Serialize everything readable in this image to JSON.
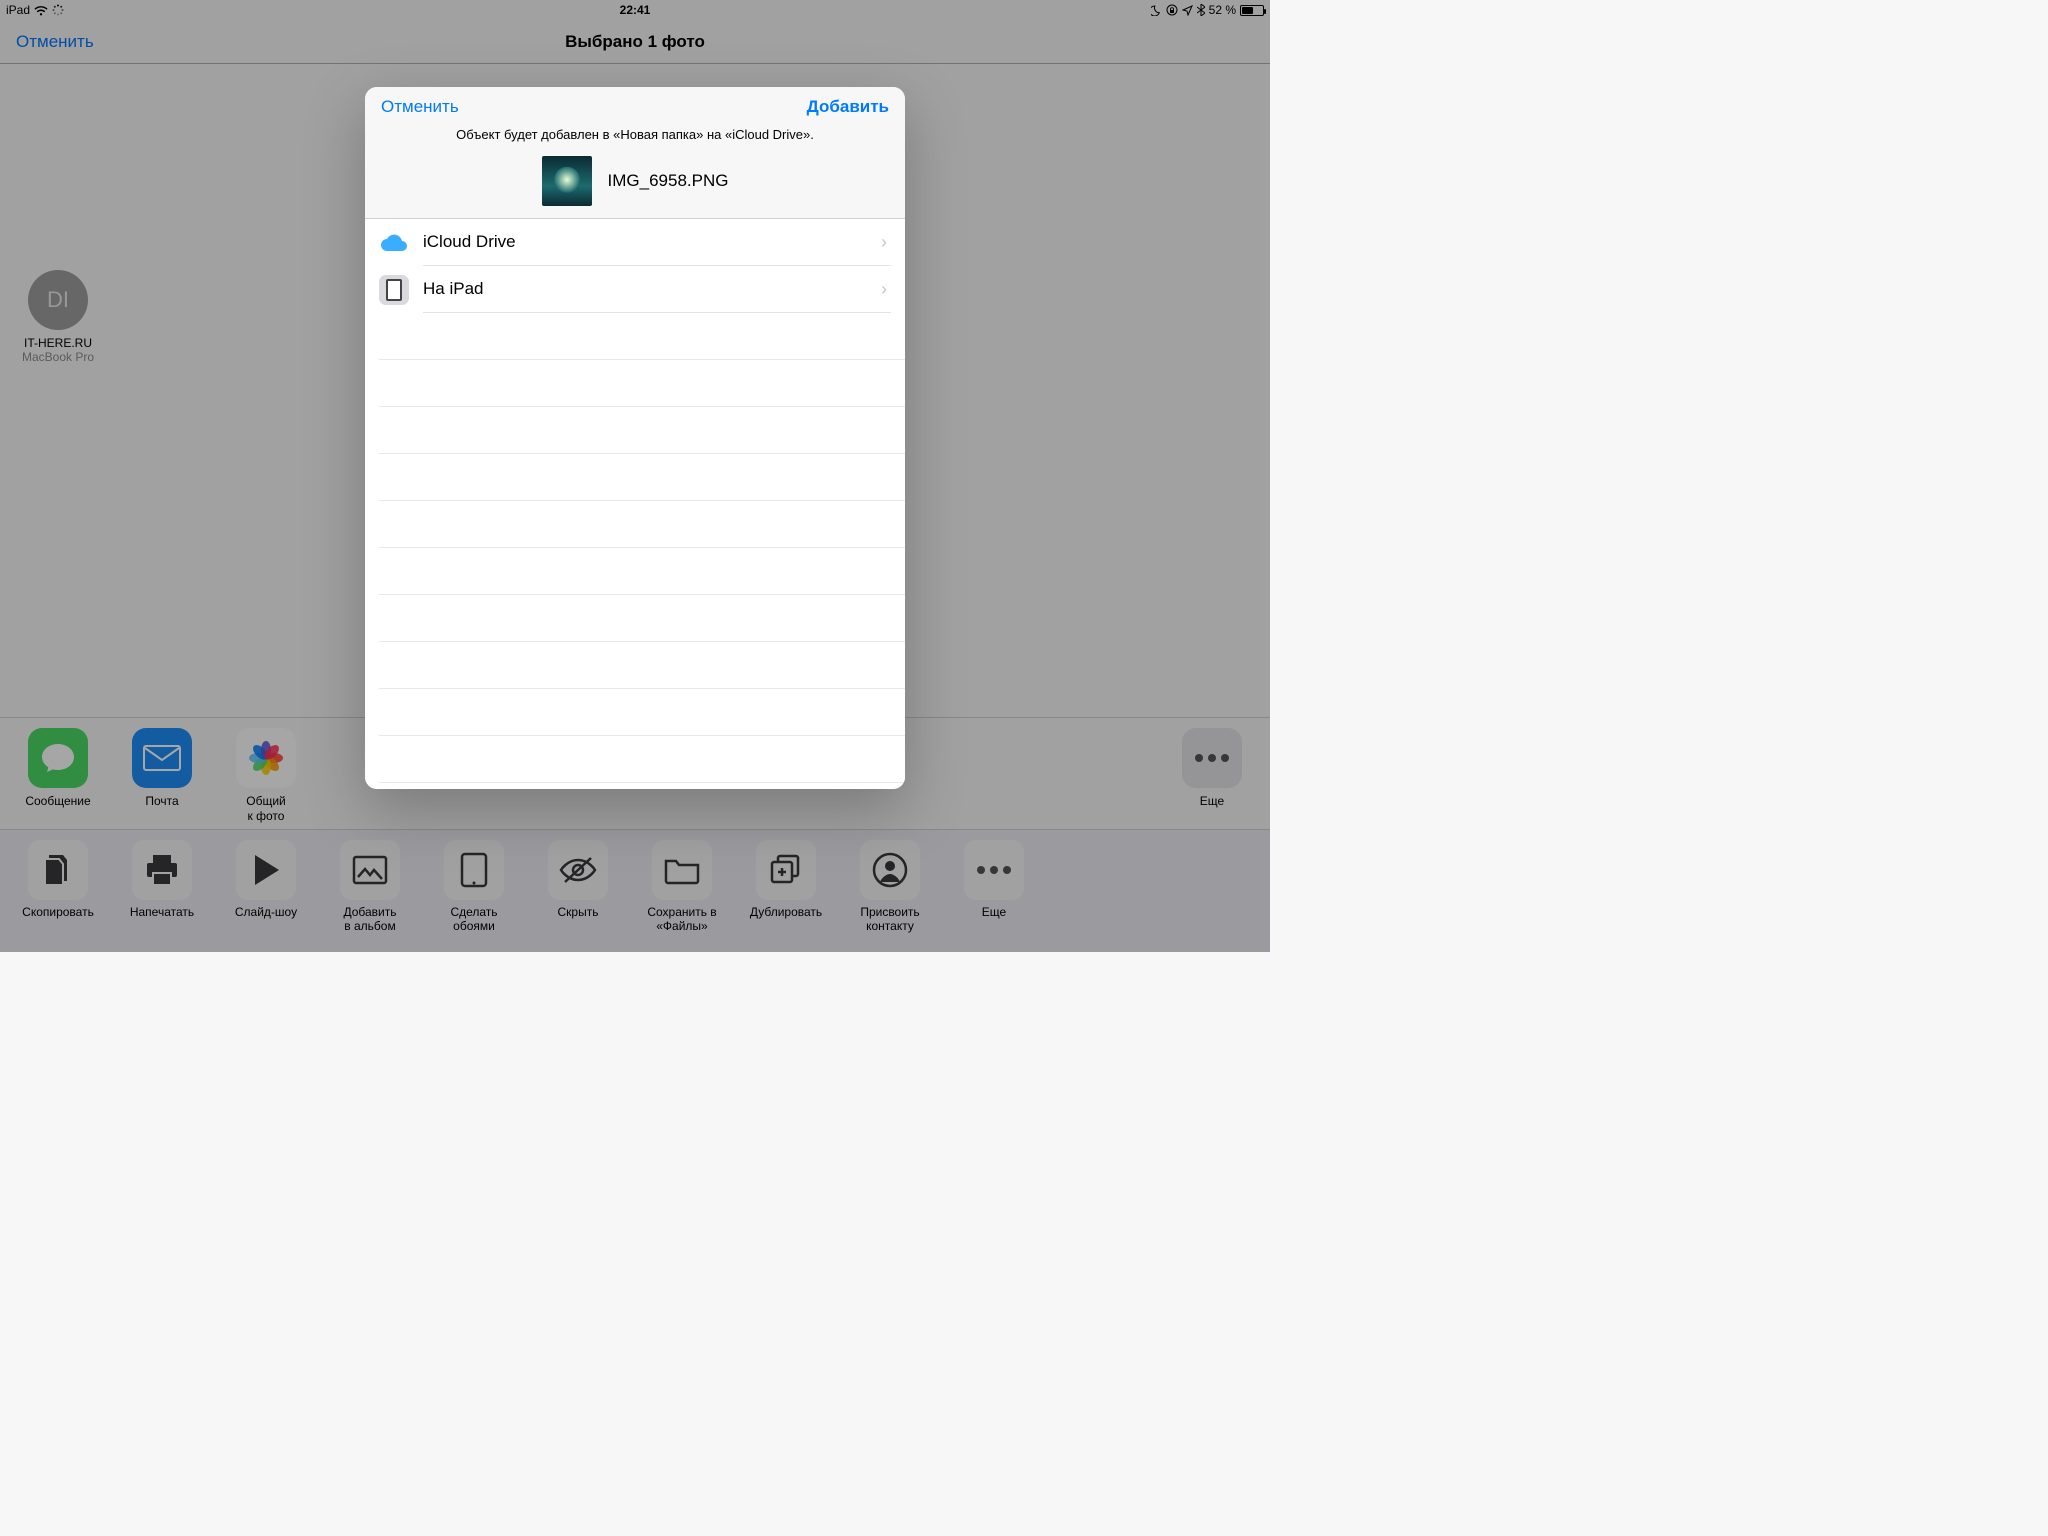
{
  "statusbar": {
    "device": "iPad",
    "time": "22:41",
    "battery_pct": "52 %"
  },
  "navbar": {
    "cancel": "Отменить",
    "title": "Выбрано 1 фото"
  },
  "airdrop": {
    "initials": "DI",
    "name": "IT-HERE.RU",
    "sub": "MacBook Pro"
  },
  "apps": {
    "message": "Сообщение",
    "mail": "Почта",
    "shared_photos": "Общий\nк фото",
    "more": "Еще"
  },
  "actions": {
    "copy": "Скопировать",
    "print": "Напечатать",
    "slideshow": "Слайд-шоу",
    "add_album": "Добавить\nв альбом",
    "wallpaper": "Сделать\nобоями",
    "hide": "Скрыть",
    "save_files": "Сохранить в\n«Файлы»",
    "duplicate": "Дублировать",
    "assign_contact": "Присвоить\nконтакту",
    "more": "Еще"
  },
  "modal": {
    "cancel": "Отменить",
    "add": "Добавить",
    "note": "Объект будет добавлен в «Новая папка» на «iCloud Drive».",
    "file_name": "IMG_6958.PNG",
    "locations": {
      "icloud": "iCloud Drive",
      "ipad": "На iPad"
    }
  }
}
